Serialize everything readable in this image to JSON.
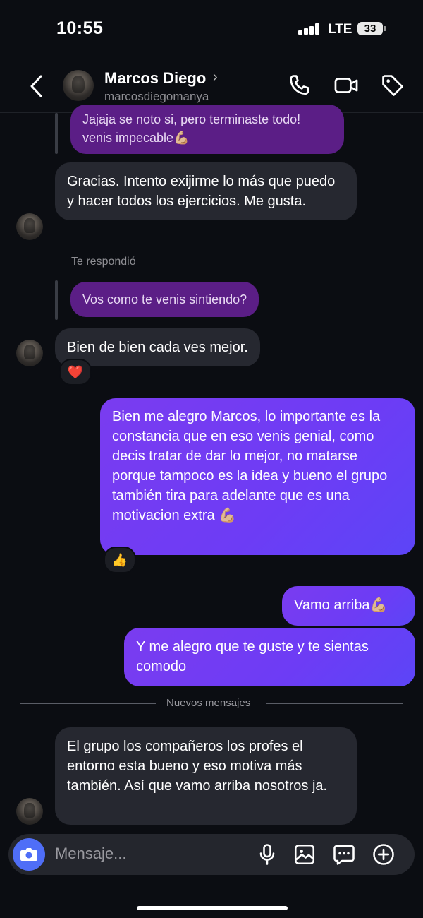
{
  "status_bar": {
    "time": "10:55",
    "network": "LTE",
    "battery": "33"
  },
  "header": {
    "name": "Marcos Diego",
    "username": "marcosdiegomanya",
    "icons": [
      "back-arrow-icon",
      "phone-icon",
      "video-camera-icon",
      "tag-icon"
    ]
  },
  "messages": {
    "m0_quoted": "Jajaja se noto si, pero terminaste todo! venis impecable💪🏼",
    "m1": "Gracias. Intento exijirme lo más que puedo y hacer todos los ejercicios. Me gusta.",
    "reply_label": "Te respondió",
    "m2_quoted": "Vos como te venis sintiendo?",
    "m3": "Bien de bien cada ves mejor.",
    "m3_reaction": "❤️",
    "m4": "Bien me alegro Marcos, lo importante es la constancia que en eso venis genial, como decis tratar de dar lo mejor, no matarse porque tampoco es la idea y bueno el grupo también tira para adelante que es una motivacion extra 💪🏼",
    "m4_reaction": "👍",
    "m5": "Vamo arriba💪🏼",
    "m6": "Y me alegro que te guste y te sientas comodo",
    "new_messages_label": "Nuevos mensajes",
    "m7": "El grupo los compañeros los profes el entorno esta bueno y eso motiva más también. Así que vamo arriba nosotros ja."
  },
  "composer": {
    "placeholder": "Mensaje...",
    "icons": [
      "camera-icon",
      "microphone-icon",
      "gallery-icon",
      "sticker-icon",
      "plus-icon"
    ]
  },
  "colors": {
    "background": "#0b0d12",
    "incoming": "#262830",
    "outgoing": "#6d3cf5",
    "quoted": "#5b1e86",
    "camera_button": "#4f6ef7"
  }
}
